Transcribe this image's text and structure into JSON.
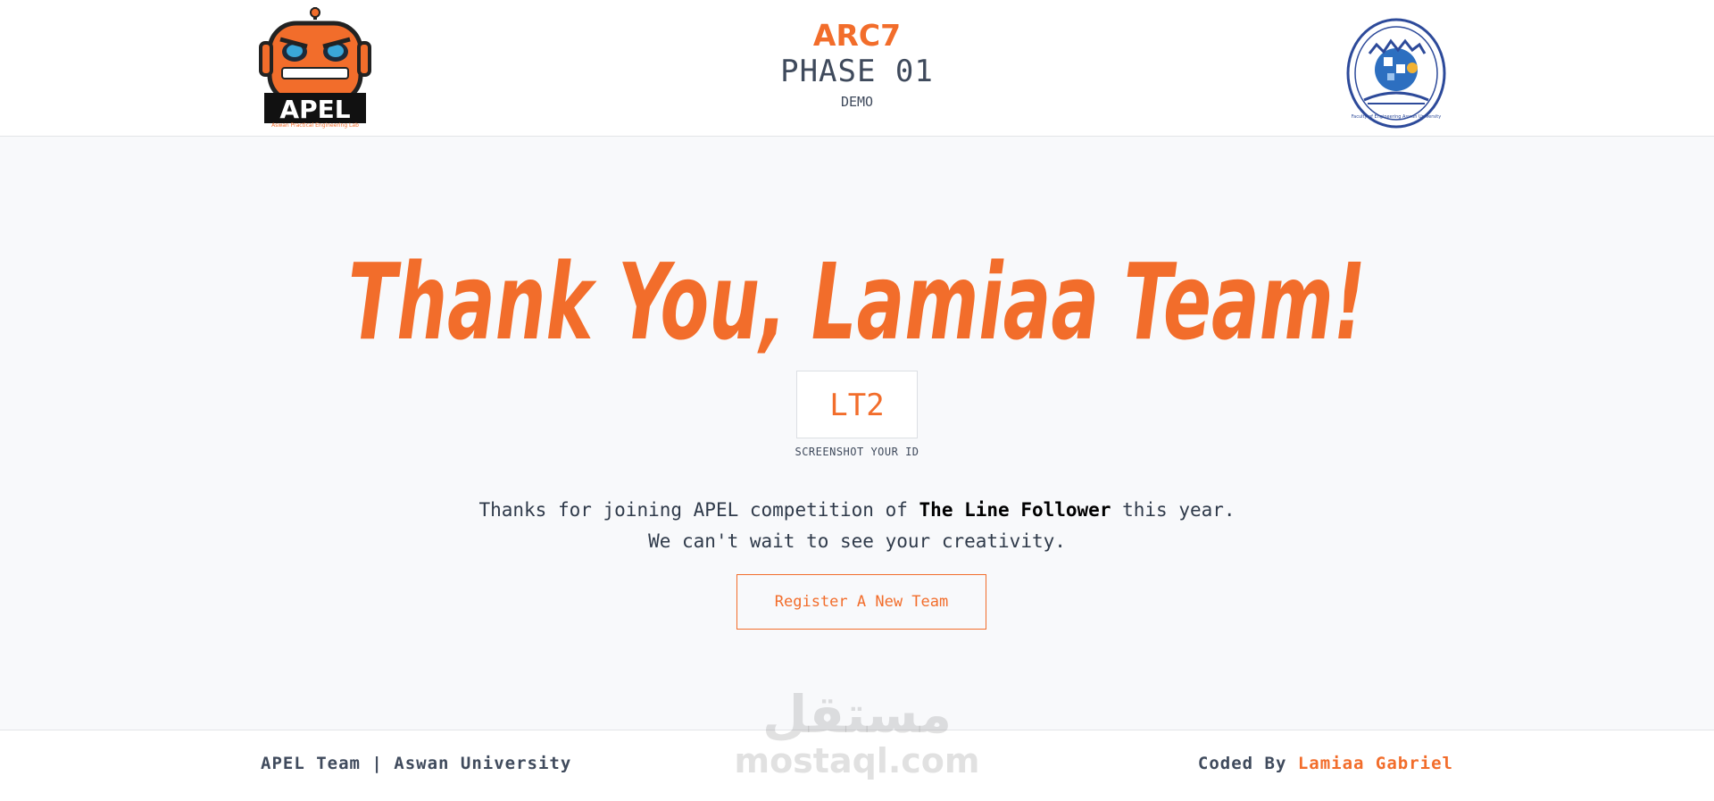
{
  "header": {
    "title": "ARC7",
    "phase": "PHASE 01",
    "subtitle": "DEMO",
    "left_logo_text": "APEL",
    "left_logo_caption": "Aswan Practical Engineering Lab",
    "right_logo_caption": "Faculty of Engineering Aswan University"
  },
  "main": {
    "headline": "Thank You, Lamiaa Team!",
    "team_id": "LT2",
    "id_caption": "SCREENSHOT YOUR ID",
    "message_prefix": "Thanks for joining APEL competition of ",
    "competition": "The Line Follower",
    "message_suffix": " this year.",
    "message_line2": "We can't wait to see your creativity.",
    "register_label": "Register A New Team"
  },
  "footer": {
    "left": "APEL Team | Aswan University",
    "right_prefix": "Coded By ",
    "author": "Lamiaa Gabriel"
  },
  "watermark": {
    "arabic": "مستقل",
    "latin": "mostaql.com"
  },
  "colors": {
    "accent": "#f26d2b",
    "text": "#3f4a5c",
    "background": "#f8f9fb"
  }
}
